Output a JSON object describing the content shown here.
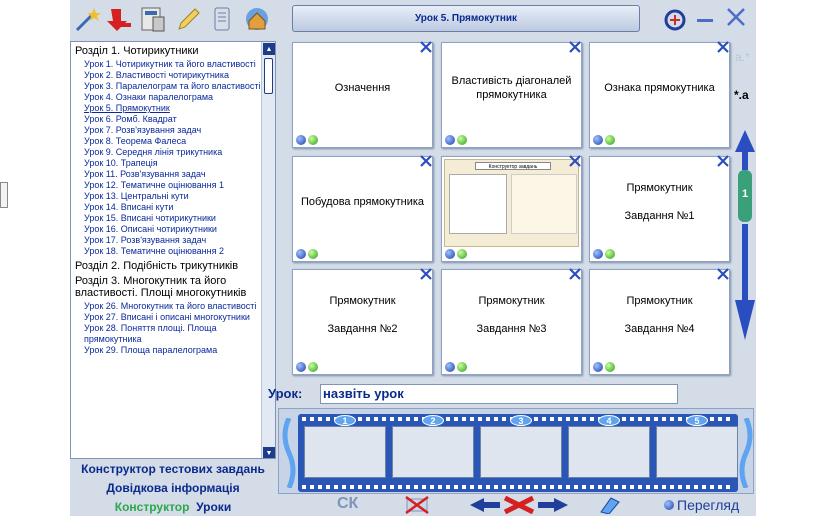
{
  "toolbar": {
    "icons": [
      "wand-icon",
      "arrow-down-red-icon",
      "calculator-doc-icon",
      "pencil-icon",
      "document-icon",
      "globe-house-icon"
    ]
  },
  "window": {
    "title": "Урок 5. Прямокутник"
  },
  "sidebar": {
    "groups": [
      {
        "title": "Розділ 1. Чотирикутники",
        "lessons": [
          "Урок 1. Чотирикутник та його властивості",
          "Урок 2. Властивості чотирикутника",
          "Урок 3. Паралелограм та його властивості",
          "Урок 4. Ознаки паралелограма",
          "Урок 5. Прямокутник",
          "Урок 6. Ромб. Квадрат",
          "Урок 7. Розв'язування задач",
          "Урок 8. Теорема Фалеса",
          "Урок 9. Середня лінія трикутника",
          "Урок 10. Трапеція",
          "Урок 11. Розв'язування задач",
          "Урок 12. Тематичне оцінювання 1",
          "Урок 13. Центральні кути",
          "Урок 14. Вписані кути",
          "Урок 15. Вписані чотирикутники",
          "Урок 16. Описані чотирикутники",
          "Урок 17. Розв'язування задач",
          "Урок 18. Тематичне оцінювання 2"
        ]
      },
      {
        "title": "Розділ 2. Подібність трикутників",
        "lessons": []
      },
      {
        "title": "Розділ 3. Многокутник та його властивості. Площі многокутників",
        "lessons": [
          "Урок 26. Многокутник та його властивості",
          "Урок 27. Вписані і описані многокутники",
          "Урок 28. Поняття площі. Площа прямокутника",
          "Урок 29. Площа паралелограма"
        ]
      }
    ],
    "active_lesson": "Урок 5. Прямокутник"
  },
  "bottom_links": {
    "tests": "Конструктор тестових завдань",
    "reference": "Довідкова інформація",
    "constructor": "Конструктор",
    "lessons": "Уроки"
  },
  "cards": [
    {
      "lines": [
        "Означення"
      ]
    },
    {
      "lines": [
        "Властивість діагоналей прямокутника"
      ]
    },
    {
      "lines": [
        "Ознака прямокутника"
      ]
    },
    {
      "lines": [
        "Побудова прямокутника"
      ]
    },
    {
      "lines": [
        "Конструктор завдань"
      ],
      "thumbnail": true
    },
    {
      "lines": [
        "Прямокутник",
        "Завдання №1"
      ]
    },
    {
      "lines": [
        "Прямокутник",
        "Завдання №2"
      ]
    },
    {
      "lines": [
        "Прямокутник",
        "Завдання №3"
      ]
    },
    {
      "lines": [
        "Прямокутник",
        "Завдання №4"
      ]
    }
  ],
  "lesson": {
    "label": "Урок:",
    "value": "назвіть урок"
  },
  "film": {
    "frames": [
      "1",
      "2",
      "3",
      "4",
      "5"
    ]
  },
  "bottom": {
    "ck": "СК",
    "preview": "Перегляд"
  },
  "side": {
    "page": "1",
    "label": "*.a",
    "faded": "a.*"
  }
}
